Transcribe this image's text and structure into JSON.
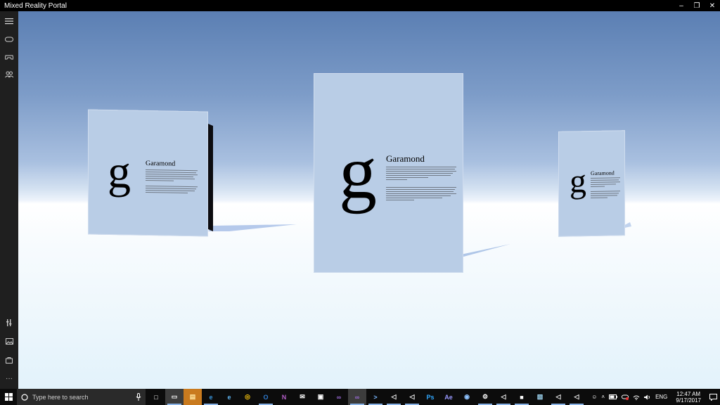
{
  "window": {
    "title": "Mixed Reality Portal",
    "minimize_glyph": "–",
    "maximize_glyph": "❐",
    "close_glyph": "✕"
  },
  "rail": {
    "top_items": [
      "menu-icon",
      "headset-icon",
      "controller-icon",
      "people-icon"
    ],
    "bottom_items": [
      "dev-tools-icon",
      "capture-icon",
      "store-icon",
      "more-icon"
    ],
    "more_glyph": "···"
  },
  "scene": {
    "cards": [
      {
        "id": "left",
        "glyph": "g",
        "title": "Garamond"
      },
      {
        "id": "center",
        "glyph": "g",
        "title": "Garamond"
      },
      {
        "id": "right",
        "glyph": "g",
        "title": "Garamond"
      }
    ]
  },
  "taskbar": {
    "search_placeholder": "Type here to search",
    "apps": [
      {
        "name": "task-view-icon",
        "label": "□"
      },
      {
        "name": "mixed-reality-portal-icon",
        "label": "▭"
      },
      {
        "name": "file-explorer-icon",
        "label": "▤"
      },
      {
        "name": "edge-icon",
        "label": "e"
      },
      {
        "name": "ie-icon",
        "label": "e"
      },
      {
        "name": "chrome-icon",
        "label": "◎"
      },
      {
        "name": "outlook-icon",
        "label": "O"
      },
      {
        "name": "onenote-icon",
        "label": "N"
      },
      {
        "name": "mail-icon",
        "label": "✉"
      },
      {
        "name": "store-icon",
        "label": "▣"
      },
      {
        "name": "visual-studio-icon",
        "label": "∞"
      },
      {
        "name": "visual-studio-preview-icon",
        "label": "∞"
      },
      {
        "name": "powershell-icon",
        "label": ">"
      },
      {
        "name": "unity-icon-1",
        "label": "◁"
      },
      {
        "name": "unity-icon-2",
        "label": "◁"
      },
      {
        "name": "photoshop-icon",
        "label": "Ps"
      },
      {
        "name": "after-effects-icon",
        "label": "Ae"
      },
      {
        "name": "globe-icon",
        "label": "◉"
      },
      {
        "name": "settings-icon",
        "label": "⚙"
      },
      {
        "name": "unity-icon-3",
        "label": "◁"
      },
      {
        "name": "camera-icon",
        "label": "■"
      },
      {
        "name": "notepad-icon",
        "label": "▧"
      },
      {
        "name": "unity-icon-4",
        "label": "◁"
      },
      {
        "name": "unity-icon-5",
        "label": "◁"
      }
    ],
    "tray": {
      "people_glyph": "☺",
      "chevron_glyph": "˄",
      "language": "ENG",
      "time": "12:47 AM",
      "date": "9/17/2017"
    }
  },
  "colors": {
    "sky_top": "#5b7fb3",
    "card": "#b9cde6",
    "taskbar": "#0c0c0c",
    "rail": "#1f1f1f"
  }
}
